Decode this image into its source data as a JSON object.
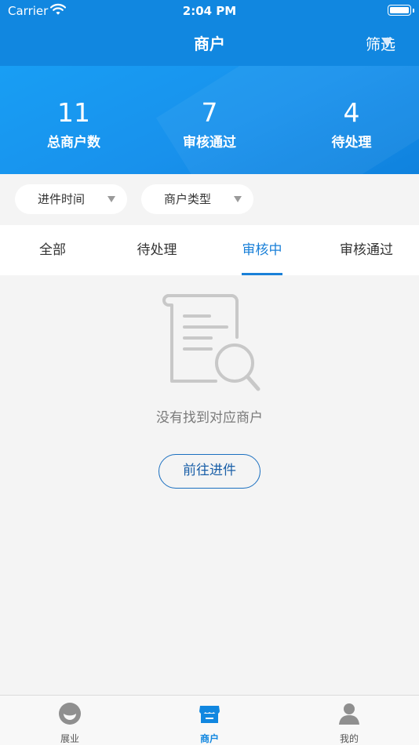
{
  "status_bar": {
    "carrier": "Carrier",
    "time": "2:04 PM"
  },
  "header": {
    "title": "商户",
    "filter_label": "筛选"
  },
  "stats": [
    {
      "value": "11",
      "label": "总商户数"
    },
    {
      "value": "7",
      "label": "审核通过"
    },
    {
      "value": "4",
      "label": "待处理"
    }
  ],
  "filters": [
    {
      "label": "进件时间"
    },
    {
      "label": "商户类型"
    }
  ],
  "tabs": [
    {
      "label": "全部"
    },
    {
      "label": "待处理"
    },
    {
      "label": "审核中"
    },
    {
      "label": "审核通过"
    }
  ],
  "active_tab": "审核中",
  "empty_state": {
    "message": "没有找到对应商户",
    "action_label": "前往进件"
  },
  "bottom_nav": [
    {
      "label": "展业"
    },
    {
      "label": "商户"
    },
    {
      "label": "我的"
    }
  ],
  "active_nav": "商户",
  "colors": {
    "primary": "#1187e0",
    "accent_text": "#1a80d8",
    "background": "#f4f4f4"
  }
}
